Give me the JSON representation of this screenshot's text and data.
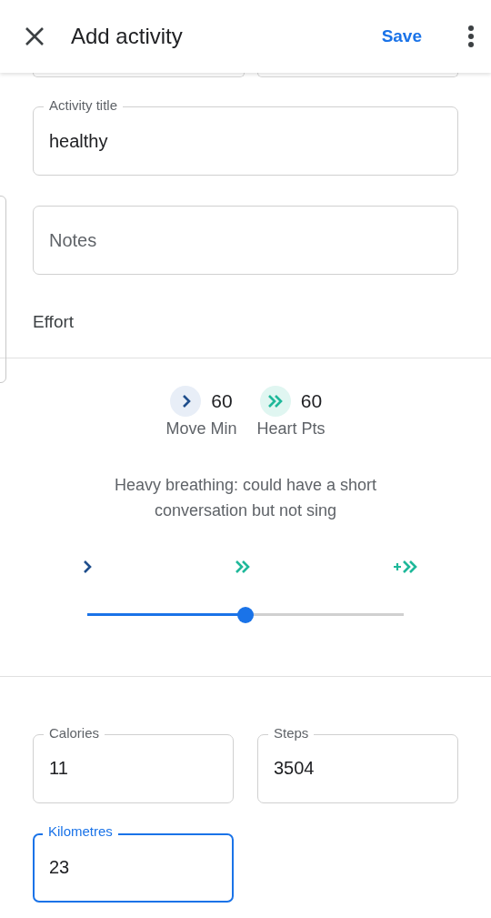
{
  "app_bar": {
    "title": "Add activity",
    "action": "Save"
  },
  "partial_fields": [
    {
      "kind": "outlined"
    },
    {
      "kind": "outlined"
    }
  ],
  "activity_title": {
    "label": "Activity title",
    "value": "healthy"
  },
  "notes": {
    "placeholder": "Notes"
  },
  "effort": {
    "label": "Effort",
    "stats": [
      {
        "kind": "move",
        "value": "60",
        "label": "Move Min"
      },
      {
        "kind": "heart",
        "value": "60",
        "label": "Heart Pts"
      }
    ],
    "description": "Heavy breathing: could have a short conversation but not sing",
    "slider": {
      "marks": [
        {
          "kind": "move"
        },
        {
          "kind": "heart"
        },
        {
          "kind": "heart_plus"
        }
      ],
      "level": 0.5
    }
  },
  "metrics": [
    {
      "label": "Calories",
      "value": "11",
      "focused": false
    },
    {
      "label": "Steps",
      "value": "3504",
      "focused": false
    },
    {
      "label": "Kilometres",
      "value": "23",
      "focused": true
    }
  ]
}
